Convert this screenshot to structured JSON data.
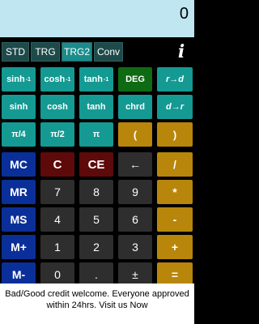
{
  "display": {
    "value": "0"
  },
  "modes": [
    "STD",
    "TRG",
    "TRG2",
    "Conv"
  ],
  "info_icon": "i",
  "sci_row1": {
    "sinh_inv": "sinh",
    "cosh_inv": "cosh",
    "tanh_inv": "tanh",
    "inv_sup": "-1",
    "deg": "DEG",
    "r_to_d": "r→d"
  },
  "sci_row2": {
    "sinh": "sinh",
    "cosh": "cosh",
    "tanh": "tanh",
    "chrd": "chrd",
    "d_to_r": "d→r"
  },
  "sci_row3": {
    "pi_4": "π/4",
    "pi_2": "π/2",
    "pi": "π",
    "lparen": "(",
    "rparen": ")"
  },
  "row_mc": {
    "mc": "MC",
    "c": "C",
    "ce": "CE",
    "back": "←",
    "div": "/"
  },
  "row_mr": {
    "mr": "MR",
    "seven": "7",
    "eight": "8",
    "nine": "9",
    "mul": "*"
  },
  "row_ms": {
    "ms": "MS",
    "four": "4",
    "five": "5",
    "six": "6",
    "sub": "-"
  },
  "row_mplus": {
    "mplus": "M+",
    "one": "1",
    "two": "2",
    "three": "3",
    "add": "+"
  },
  "row_mminus": {
    "mminus": "M-",
    "zero": "0",
    "dot": ".",
    "pm": "±",
    "eq": "="
  },
  "ad": {
    "text": "Bad/Good credit welcome. Everyone approved within 24hrs. Visit us Now"
  },
  "colors": {
    "display_bg": "#bfe6f1",
    "teal": "#149a93",
    "green": "#0f6a14",
    "orange": "#b8860b",
    "blue": "#0b2f99",
    "red": "#5e0a0a",
    "gray": "#2e2e2e"
  }
}
